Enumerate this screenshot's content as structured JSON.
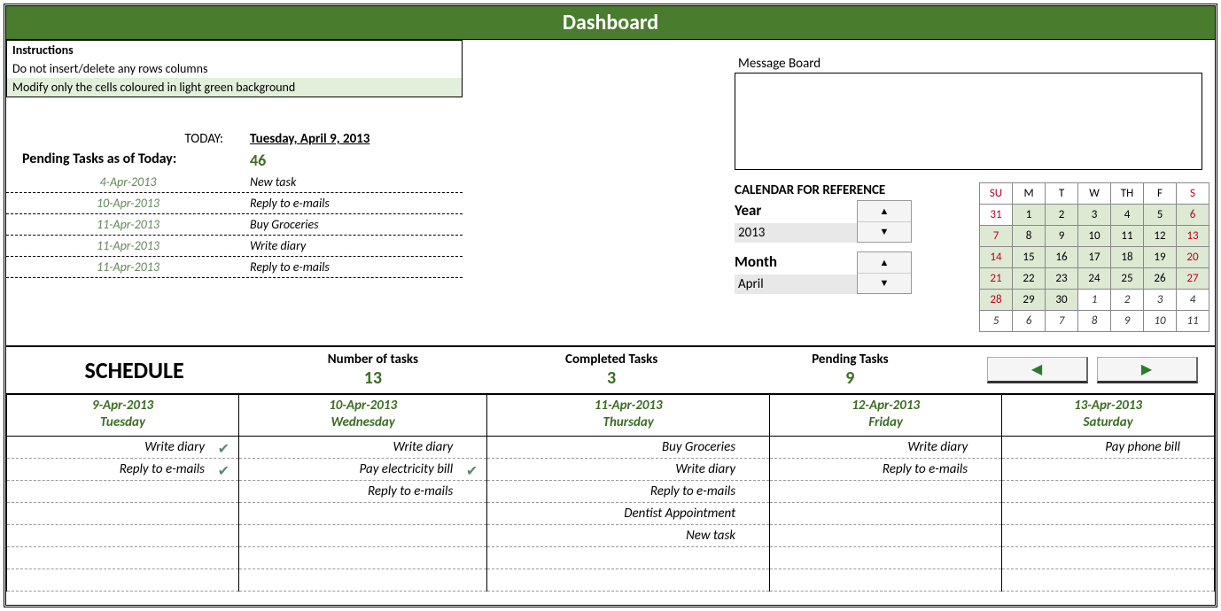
{
  "title": "Dashboard",
  "instructions": {
    "heading": "Instructions",
    "line1": "Do not insert/delete any rows columns",
    "line2": "Modify only the cells coloured in light green background"
  },
  "today": {
    "label": "TODAY:",
    "value": "Tuesday, April 9, 2013"
  },
  "pending": {
    "label": "Pending Tasks as of Today:",
    "count": "46"
  },
  "pending_list": [
    {
      "date": "4-Apr-2013",
      "task": "New task"
    },
    {
      "date": "10-Apr-2013",
      "task": "Reply to e-mails"
    },
    {
      "date": "11-Apr-2013",
      "task": "Buy Groceries"
    },
    {
      "date": "11-Apr-2013",
      "task": "Write diary"
    },
    {
      "date": "11-Apr-2013",
      "task": "Reply to e-mails"
    }
  ],
  "message_board": {
    "label": "Message Board"
  },
  "calendar_ref": {
    "title": "CALENDAR FOR REFERENCE",
    "year_label": "Year",
    "year_value": "2013",
    "month_label": "Month",
    "month_value": "April",
    "headers": [
      "SU",
      "M",
      "T",
      "W",
      "TH",
      "F",
      "S"
    ],
    "weeks": [
      [
        {
          "d": "31",
          "cls": "prev"
        },
        {
          "d": "1",
          "cls": "g"
        },
        {
          "d": "2",
          "cls": "g"
        },
        {
          "d": "3",
          "cls": "g"
        },
        {
          "d": "4",
          "cls": "g"
        },
        {
          "d": "5",
          "cls": "g"
        },
        {
          "d": "6",
          "cls": "g sat"
        }
      ],
      [
        {
          "d": "7",
          "cls": "g sun"
        },
        {
          "d": "8",
          "cls": "g"
        },
        {
          "d": "9",
          "cls": "g"
        },
        {
          "d": "10",
          "cls": "g"
        },
        {
          "d": "11",
          "cls": "g"
        },
        {
          "d": "12",
          "cls": "g"
        },
        {
          "d": "13",
          "cls": "g sat"
        }
      ],
      [
        {
          "d": "14",
          "cls": "g sun"
        },
        {
          "d": "15",
          "cls": "g"
        },
        {
          "d": "16",
          "cls": "g"
        },
        {
          "d": "17",
          "cls": "g"
        },
        {
          "d": "18",
          "cls": "g"
        },
        {
          "d": "19",
          "cls": "g"
        },
        {
          "d": "20",
          "cls": "g sat"
        }
      ],
      [
        {
          "d": "21",
          "cls": "g sun"
        },
        {
          "d": "22",
          "cls": "g"
        },
        {
          "d": "23",
          "cls": "g"
        },
        {
          "d": "24",
          "cls": "g"
        },
        {
          "d": "25",
          "cls": "g"
        },
        {
          "d": "26",
          "cls": "g"
        },
        {
          "d": "27",
          "cls": "g sat"
        }
      ],
      [
        {
          "d": "28",
          "cls": "g sun"
        },
        {
          "d": "29",
          "cls": "g"
        },
        {
          "d": "30",
          "cls": "g"
        },
        {
          "d": "1",
          "cls": "other"
        },
        {
          "d": "2",
          "cls": "other"
        },
        {
          "d": "3",
          "cls": "other"
        },
        {
          "d": "4",
          "cls": "other sat"
        }
      ],
      [
        {
          "d": "5",
          "cls": "other sun"
        },
        {
          "d": "6",
          "cls": "other"
        },
        {
          "d": "7",
          "cls": "other"
        },
        {
          "d": "8",
          "cls": "other"
        },
        {
          "d": "9",
          "cls": "other"
        },
        {
          "d": "10",
          "cls": "other"
        },
        {
          "d": "11",
          "cls": "other sat"
        }
      ]
    ]
  },
  "stats": {
    "schedule_label": "SCHEDULE",
    "num_tasks_label": "Number of tasks",
    "num_tasks": "13",
    "completed_label": "Completed Tasks",
    "completed": "3",
    "pending_label": "Pending Tasks",
    "pending": "9"
  },
  "nav": {
    "prev_glyph": "◀",
    "next_glyph": "▶"
  },
  "schedule_days": [
    {
      "date": "9-Apr-2013",
      "dow": "Tuesday",
      "tasks": [
        {
          "t": "Write diary",
          "done": true
        },
        {
          "t": "Reply to e-mails",
          "done": true
        }
      ]
    },
    {
      "date": "10-Apr-2013",
      "dow": "Wednesday",
      "tasks": [
        {
          "t": "Write diary"
        },
        {
          "t": "Pay electricity bill",
          "done": true
        },
        {
          "t": "Reply to e-mails"
        }
      ]
    },
    {
      "date": "11-Apr-2013",
      "dow": "Thursday",
      "tasks": [
        {
          "t": "Buy Groceries"
        },
        {
          "t": "Write diary"
        },
        {
          "t": "Reply to e-mails"
        },
        {
          "t": "Dentist Appointment"
        },
        {
          "t": "New task"
        }
      ]
    },
    {
      "date": "12-Apr-2013",
      "dow": "Friday",
      "tasks": [
        {
          "t": "Write diary"
        },
        {
          "t": "Reply to e-mails"
        }
      ]
    },
    {
      "date": "13-Apr-2013",
      "dow": "Saturday",
      "tasks": [
        {
          "t": "Pay phone bill"
        }
      ]
    }
  ],
  "schedule_rows": 7
}
